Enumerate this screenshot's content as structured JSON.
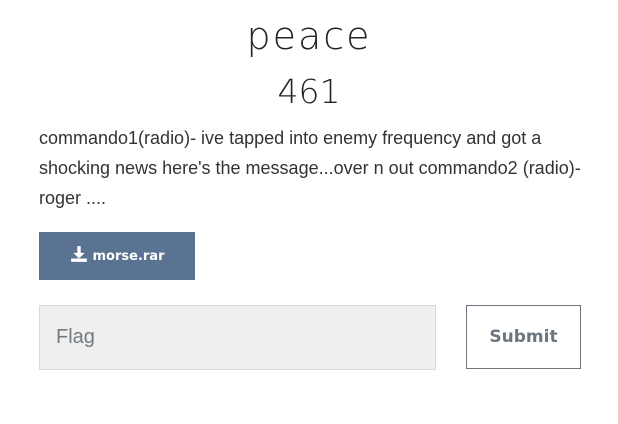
{
  "challenge": {
    "name": "peace",
    "value": "461",
    "description": "commando1(radio)- ive tapped into enemy frequency and got a shocking news here's the message...over n out commando2 (radio)- roger ....",
    "file": {
      "icon": "download-icon",
      "label": "morse.rar"
    }
  },
  "form": {
    "flag_placeholder": "Flag",
    "flag_value": "",
    "submit_label": "Submit"
  },
  "colors": {
    "download_button": "#5b7392",
    "submit_border": "#6c757d",
    "input_background": "#efefef"
  }
}
